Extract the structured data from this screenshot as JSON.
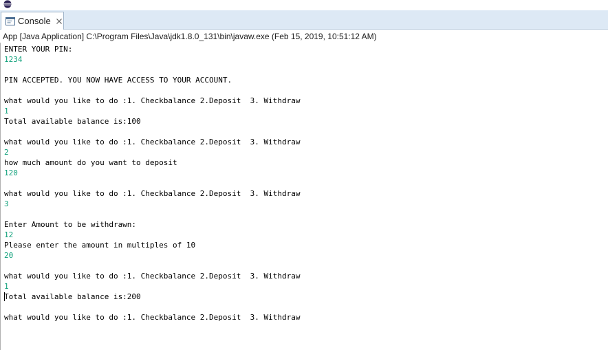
{
  "tab": {
    "label": "Console",
    "icon": "console-icon",
    "close_icon": "close-icon"
  },
  "launch_info": "App [Java Application] C:\\Program Files\\Java\\jdk1.8.0_131\\bin\\javaw.exe (Feb 15, 2019, 10:51:12 AM)",
  "colors": {
    "tabbar": "#dde9f5",
    "input_text": "#0fa07a",
    "output_text": "#000000"
  },
  "console": {
    "lines": [
      {
        "text": "ENTER YOUR PIN:",
        "kind": "output"
      },
      {
        "text": "1234",
        "kind": "input"
      },
      {
        "text": "",
        "kind": "output"
      },
      {
        "text": "PIN ACCEPTED. YOU NOW HAVE ACCESS TO YOUR ACCOUNT.",
        "kind": "output"
      },
      {
        "text": "",
        "kind": "output"
      },
      {
        "text": "what would you like to do :1. Checkbalance 2.Deposit  3. Withdraw",
        "kind": "output"
      },
      {
        "text": "1",
        "kind": "input"
      },
      {
        "text": "Total available balance is:100",
        "kind": "output"
      },
      {
        "text": "",
        "kind": "output"
      },
      {
        "text": "what would you like to do :1. Checkbalance 2.Deposit  3. Withdraw",
        "kind": "output"
      },
      {
        "text": "2",
        "kind": "input"
      },
      {
        "text": "how much amount do you want to deposit",
        "kind": "output"
      },
      {
        "text": "120",
        "kind": "input"
      },
      {
        "text": "",
        "kind": "output"
      },
      {
        "text": "what would you like to do :1. Checkbalance 2.Deposit  3. Withdraw",
        "kind": "output"
      },
      {
        "text": "3",
        "kind": "input"
      },
      {
        "text": "",
        "kind": "output"
      },
      {
        "text": "Enter Amount to be withdrawn:",
        "kind": "output"
      },
      {
        "text": "12",
        "kind": "input"
      },
      {
        "text": "Please enter the amount in multiples of 10",
        "kind": "output"
      },
      {
        "text": "20",
        "kind": "input"
      },
      {
        "text": "",
        "kind": "output"
      },
      {
        "text": "what would you like to do :1. Checkbalance 2.Deposit  3. Withdraw",
        "kind": "output"
      },
      {
        "text": "1",
        "kind": "input"
      },
      {
        "text": "Total available balance is:200",
        "kind": "output"
      },
      {
        "text": "",
        "kind": "output"
      },
      {
        "text": "what would you like to do :1. Checkbalance 2.Deposit  3. Withdraw",
        "kind": "output"
      }
    ]
  }
}
